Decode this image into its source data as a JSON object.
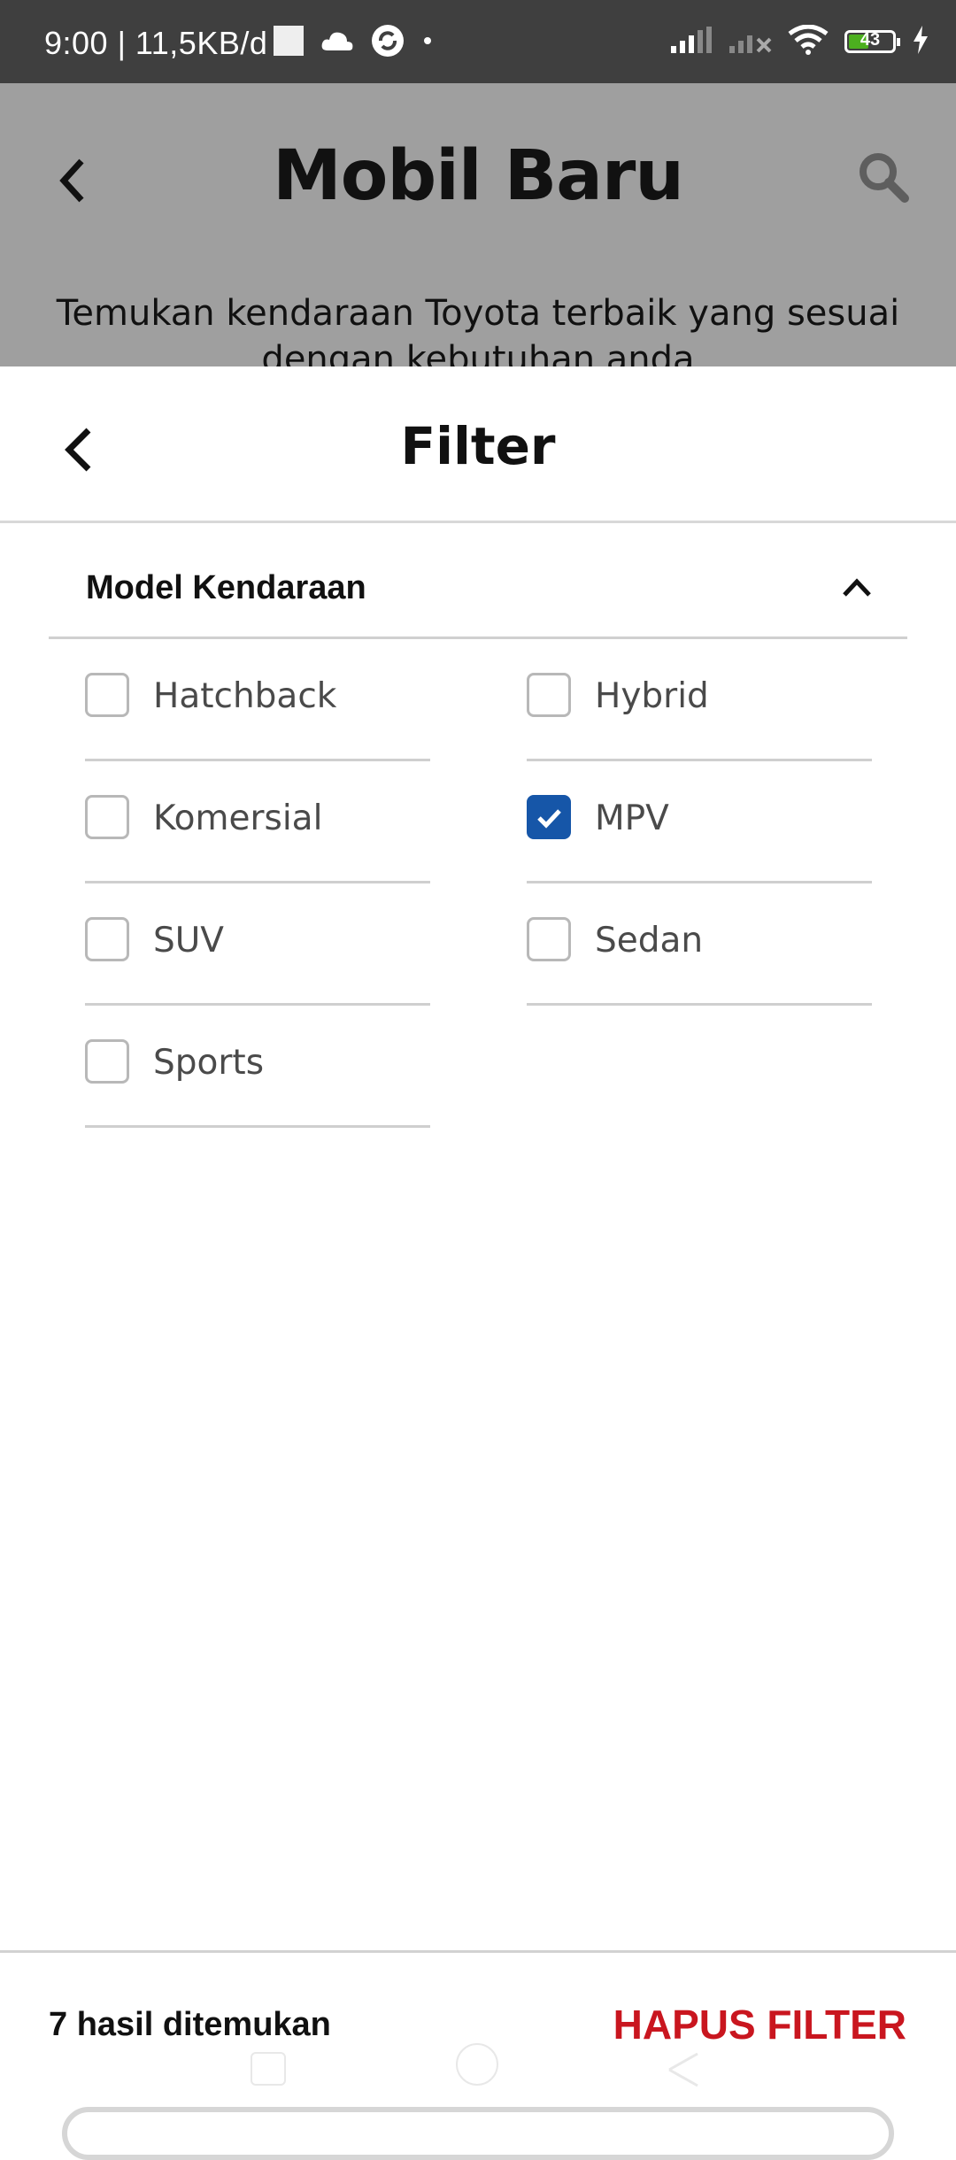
{
  "status_bar": {
    "time_text": "9:00 | 11,5KB/d",
    "battery_level": "43",
    "icons": [
      "notification-square-icon",
      "cloud-icon",
      "sync-icon",
      "dot-icon",
      "signal-icon",
      "signal-no-service-icon",
      "wifi-icon",
      "battery-icon",
      "charging-icon"
    ]
  },
  "background_page": {
    "title": "Mobil Baru",
    "subtitle": "Temukan kendaraan Toyota terbaik yang sesuai dengan kebutuhan anda"
  },
  "filter_sheet": {
    "title": "Filter",
    "section_title": "Model Kendaraan",
    "options": [
      {
        "label": "Hatchback",
        "checked": false
      },
      {
        "label": "Hybrid",
        "checked": false
      },
      {
        "label": "Komersial",
        "checked": false
      },
      {
        "label": "MPV",
        "checked": true
      },
      {
        "label": "SUV",
        "checked": false
      },
      {
        "label": "Sedan",
        "checked": false
      },
      {
        "label": "Sports",
        "checked": false
      }
    ]
  },
  "footer": {
    "results_text": "7 hasil ditemukan",
    "clear_label": "HAPUS FILTER"
  },
  "colors": {
    "accent_blue": "#1656a8",
    "clear_red": "#c9161f",
    "overlay_gray": "#9f9f9f"
  }
}
